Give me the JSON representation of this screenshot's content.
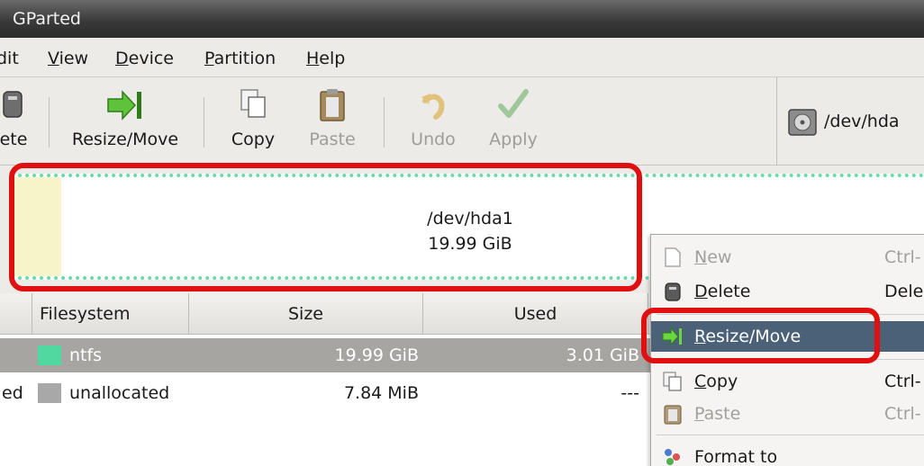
{
  "window": {
    "title": "GParted"
  },
  "menubar": {
    "edit": "dit",
    "view": "View",
    "device": "Device",
    "partition": "Partition",
    "help": "Help"
  },
  "toolbar": {
    "delete_label": "ete",
    "resize_label": "Resize/Move",
    "copy_label": "Copy",
    "paste_label": "Paste",
    "undo_label": "Undo",
    "apply_label": "Apply",
    "device": "/dev/hda"
  },
  "graph": {
    "partition_name": "/dev/hda1",
    "partition_size": "19.99 GiB",
    "fs_color": "#66ddaa",
    "used_color": "#f8f4c9"
  },
  "table": {
    "headers": {
      "filesystem": "Filesystem",
      "size": "Size",
      "used": "Used"
    },
    "rows": [
      {
        "partition": "",
        "filesystem": "ntfs",
        "size": "19.99 GiB",
        "used": "3.01 GiB",
        "swatch": "#50d8a0",
        "selected": true
      },
      {
        "partition": "ed",
        "filesystem": "unallocated",
        "size": "7.84 MiB",
        "used": "---",
        "swatch": "#a8a8a8",
        "selected": false
      }
    ]
  },
  "context_menu": {
    "items": [
      {
        "label": "New",
        "accel": "Ctrl-",
        "enabled": false,
        "icon": "new-icon"
      },
      {
        "label": "Delete",
        "accel": "Dele",
        "enabled": true,
        "icon": "delete-icon"
      },
      {
        "label": "Resize/Move",
        "accel": "",
        "enabled": true,
        "selected": true,
        "icon": "resize-move-icon"
      },
      {
        "label": "Copy",
        "accel": "Ctrl-",
        "enabled": true,
        "icon": "copy-icon"
      },
      {
        "label": "Paste",
        "accel": "Ctrl-",
        "enabled": false,
        "icon": "paste-icon"
      },
      {
        "label": "Format to",
        "accel": "",
        "enabled": true,
        "icon": "format-icon"
      }
    ]
  },
  "annotations": {
    "highlight_color": "#e01010"
  }
}
